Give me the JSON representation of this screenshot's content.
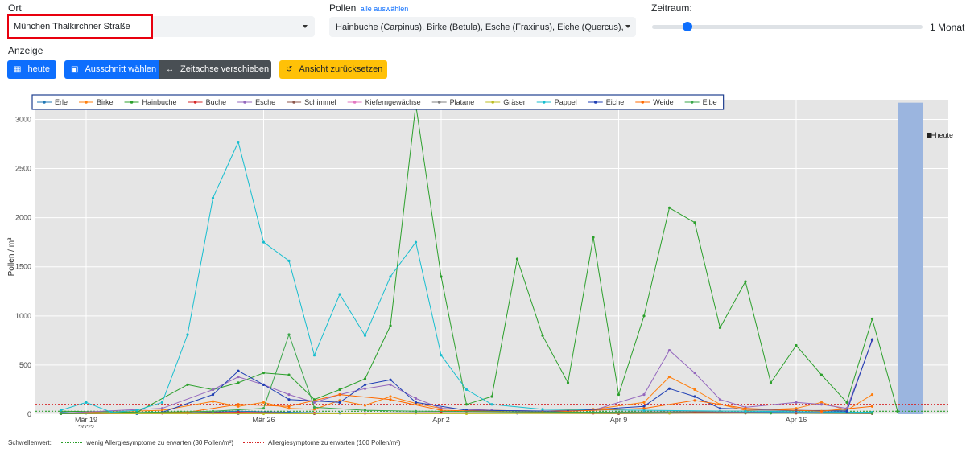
{
  "controls": {
    "ort_label": "Ort",
    "ort_value": "München Thalkirchner Straße",
    "pollen_label": "Pollen",
    "pollen_select_all": "alle auswählen",
    "pollen_value": "Hainbuche (Carpinus), Birke (Betula), Esche (Fraxinus), Eiche (Quercus), Pappe",
    "zeitraum_label": "Zeitraum:",
    "zeitraum_value": "1 Monat",
    "zeitraum_slider_fraction": 0.13,
    "anzeige_label": "Anzeige"
  },
  "buttons": {
    "heute": "heute",
    "ausschnitt": "Ausschnitt wählen",
    "zeitachse": "Zeitachse verschieben",
    "reset": "Ansicht zurücksetzen"
  },
  "colors": {
    "primary": "#0d6efd",
    "dark": "#212529",
    "warning": "#ffc107",
    "highlight_border": "#e8000e",
    "plot_bg": "#e5e5e5",
    "today_bar": "#9bb5df",
    "threshold_low": "#2ca02c",
    "threshold_high": "#d62728"
  },
  "legend_footer": {
    "label": "Schwellenwert:",
    "low": "wenig Allergiesymptome zu erwarten (30 Pollen/m³)",
    "high": "Allergiesymptome zu erwarten (100 Pollen/m³)"
  },
  "chart_data": {
    "type": "line",
    "ylabel": "Pollen / m³",
    "xlim": [
      "2023-03-17",
      "2023-04-22"
    ],
    "ylim": [
      0,
      3200
    ],
    "yticks": [
      0,
      500,
      1000,
      1500,
      2000,
      2500,
      3000
    ],
    "xticks": [
      {
        "date": "2023-03-19",
        "label": "Mär 19",
        "sublabel": "2023"
      },
      {
        "date": "2023-03-26",
        "label": "Mär 26",
        "sublabel": ""
      },
      {
        "date": "2023-04-02",
        "label": "Apr 2",
        "sublabel": ""
      },
      {
        "date": "2023-04-09",
        "label": "Apr 9",
        "sublabel": ""
      },
      {
        "date": "2023-04-16",
        "label": "Apr 16",
        "sublabel": ""
      }
    ],
    "today": {
      "label": "heute",
      "start": "2023-04-20",
      "end": "2023-04-21"
    },
    "thresholds": [
      {
        "value": 30,
        "color": "#2ca02c"
      },
      {
        "value": 100,
        "color": "#d62728"
      }
    ],
    "legend_position": "top-left",
    "grid": true,
    "series": [
      {
        "name": "Erle",
        "color": "#1f77b4",
        "points": [
          [
            "2023-03-18",
            20
          ],
          [
            "2023-03-19",
            10
          ],
          [
            "2023-03-21",
            5
          ],
          [
            "2023-03-23",
            15
          ],
          [
            "2023-03-25",
            30
          ],
          [
            "2023-03-27",
            20
          ],
          [
            "2023-03-29",
            10
          ],
          [
            "2023-04-01",
            15
          ],
          [
            "2023-04-05",
            10
          ],
          [
            "2023-04-10",
            20
          ],
          [
            "2023-04-15",
            20
          ],
          [
            "2023-04-19",
            20
          ]
        ]
      },
      {
        "name": "Birke",
        "color": "#ff7f0e",
        "points": [
          [
            "2023-03-18",
            10
          ],
          [
            "2023-03-22",
            40
          ],
          [
            "2023-03-24",
            130
          ],
          [
            "2023-03-25",
            80
          ],
          [
            "2023-03-26",
            120
          ],
          [
            "2023-03-27",
            60
          ],
          [
            "2023-03-28",
            50
          ],
          [
            "2023-03-29",
            140
          ],
          [
            "2023-03-30",
            90
          ],
          [
            "2023-03-31",
            180
          ],
          [
            "2023-04-01",
            110
          ],
          [
            "2023-04-02",
            60
          ],
          [
            "2023-04-04",
            40
          ],
          [
            "2023-04-06",
            30
          ],
          [
            "2023-04-08",
            50
          ],
          [
            "2023-04-10",
            120
          ],
          [
            "2023-04-11",
            380
          ],
          [
            "2023-04-12",
            250
          ],
          [
            "2023-04-13",
            100
          ],
          [
            "2023-04-14",
            40
          ],
          [
            "2023-04-16",
            60
          ],
          [
            "2023-04-17",
            120
          ],
          [
            "2023-04-18",
            40
          ],
          [
            "2023-04-19",
            200
          ]
        ]
      },
      {
        "name": "Hainbuche",
        "color": "#2ca02c",
        "points": [
          [
            "2023-03-18",
            30
          ],
          [
            "2023-03-21",
            20
          ],
          [
            "2023-03-23",
            300
          ],
          [
            "2023-03-24",
            250
          ],
          [
            "2023-03-25",
            320
          ],
          [
            "2023-03-26",
            420
          ],
          [
            "2023-03-27",
            400
          ],
          [
            "2023-03-28",
            150
          ],
          [
            "2023-03-29",
            250
          ],
          [
            "2023-03-30",
            360
          ],
          [
            "2023-03-31",
            900
          ],
          [
            "2023-04-01",
            3150
          ],
          [
            "2023-04-02",
            1400
          ],
          [
            "2023-04-03",
            100
          ],
          [
            "2023-04-04",
            180
          ],
          [
            "2023-04-05",
            1580
          ],
          [
            "2023-04-06",
            800
          ],
          [
            "2023-04-07",
            320
          ],
          [
            "2023-04-08",
            1800
          ],
          [
            "2023-04-09",
            200
          ],
          [
            "2023-04-10",
            1000
          ],
          [
            "2023-04-11",
            2100
          ],
          [
            "2023-04-12",
            1950
          ],
          [
            "2023-04-13",
            880
          ],
          [
            "2023-04-14",
            1350
          ],
          [
            "2023-04-15",
            320
          ],
          [
            "2023-04-16",
            700
          ],
          [
            "2023-04-17",
            400
          ],
          [
            "2023-04-18",
            120
          ],
          [
            "2023-04-19",
            970
          ],
          [
            "2023-04-20",
            30
          ]
        ]
      },
      {
        "name": "Buche",
        "color": "#d62728",
        "points": [
          [
            "2023-03-18",
            5
          ],
          [
            "2023-03-22",
            10
          ],
          [
            "2023-03-25",
            20
          ],
          [
            "2023-03-28",
            10
          ],
          [
            "2023-04-02",
            15
          ],
          [
            "2023-04-08",
            10
          ],
          [
            "2023-04-12",
            20
          ],
          [
            "2023-04-16",
            10
          ],
          [
            "2023-04-19",
            15
          ]
        ]
      },
      {
        "name": "Esche",
        "color": "#9467bd",
        "points": [
          [
            "2023-03-18",
            10
          ],
          [
            "2023-03-22",
            60
          ],
          [
            "2023-03-24",
            250
          ],
          [
            "2023-03-25",
            380
          ],
          [
            "2023-03-26",
            300
          ],
          [
            "2023-03-27",
            200
          ],
          [
            "2023-03-28",
            120
          ],
          [
            "2023-03-29",
            200
          ],
          [
            "2023-03-30",
            260
          ],
          [
            "2023-03-31",
            300
          ],
          [
            "2023-04-01",
            160
          ],
          [
            "2023-04-02",
            60
          ],
          [
            "2023-04-04",
            40
          ],
          [
            "2023-04-06",
            30
          ],
          [
            "2023-04-08",
            40
          ],
          [
            "2023-04-10",
            200
          ],
          [
            "2023-04-11",
            650
          ],
          [
            "2023-04-12",
            420
          ],
          [
            "2023-04-13",
            150
          ],
          [
            "2023-04-14",
            70
          ],
          [
            "2023-04-16",
            120
          ],
          [
            "2023-04-17",
            100
          ],
          [
            "2023-04-18",
            60
          ],
          [
            "2023-04-19",
            750
          ]
        ]
      },
      {
        "name": "Schimmel",
        "color": "#8c564b",
        "points": [
          [
            "2023-03-18",
            5
          ],
          [
            "2023-03-23",
            10
          ],
          [
            "2023-03-28",
            5
          ],
          [
            "2023-04-03",
            10
          ],
          [
            "2023-04-09",
            5
          ],
          [
            "2023-04-14",
            10
          ],
          [
            "2023-04-19",
            5
          ]
        ]
      },
      {
        "name": "Kieferngewächse",
        "color": "#e377c2",
        "points": [
          [
            "2023-03-18",
            5
          ],
          [
            "2023-03-24",
            10
          ],
          [
            "2023-03-30",
            8
          ],
          [
            "2023-04-05",
            12
          ],
          [
            "2023-04-11",
            10
          ],
          [
            "2023-04-17",
            15
          ]
        ]
      },
      {
        "name": "Platane",
        "color": "#7f7f7f",
        "points": [
          [
            "2023-03-18",
            5
          ],
          [
            "2023-03-25",
            5
          ],
          [
            "2023-04-01",
            10
          ],
          [
            "2023-04-08",
            20
          ],
          [
            "2023-04-13",
            30
          ],
          [
            "2023-04-18",
            40
          ]
        ]
      },
      {
        "name": "Gräser",
        "color": "#bcbd22",
        "points": [
          [
            "2023-03-18",
            5
          ],
          [
            "2023-03-26",
            5
          ],
          [
            "2023-04-03",
            5
          ],
          [
            "2023-04-11",
            10
          ],
          [
            "2023-04-19",
            10
          ]
        ]
      },
      {
        "name": "Pappel",
        "color": "#17becf",
        "points": [
          [
            "2023-03-18",
            40
          ],
          [
            "2023-03-19",
            120
          ],
          [
            "2023-03-20",
            20
          ],
          [
            "2023-03-21",
            40
          ],
          [
            "2023-03-22",
            120
          ],
          [
            "2023-03-23",
            810
          ],
          [
            "2023-03-24",
            2200
          ],
          [
            "2023-03-25",
            2770
          ],
          [
            "2023-03-26",
            1750
          ],
          [
            "2023-03-27",
            1560
          ],
          [
            "2023-03-28",
            600
          ],
          [
            "2023-03-29",
            1220
          ],
          [
            "2023-03-30",
            800
          ],
          [
            "2023-03-31",
            1400
          ],
          [
            "2023-04-01",
            1750
          ],
          [
            "2023-04-02",
            600
          ],
          [
            "2023-04-03",
            250
          ],
          [
            "2023-04-04",
            100
          ],
          [
            "2023-04-06",
            50
          ],
          [
            "2023-04-10",
            40
          ],
          [
            "2023-04-14",
            30
          ],
          [
            "2023-04-19",
            20
          ]
        ]
      },
      {
        "name": "Eiche",
        "color": "#1f3fb4",
        "points": [
          [
            "2023-03-18",
            5
          ],
          [
            "2023-03-22",
            20
          ],
          [
            "2023-03-24",
            200
          ],
          [
            "2023-03-25",
            440
          ],
          [
            "2023-03-26",
            300
          ],
          [
            "2023-03-27",
            150
          ],
          [
            "2023-03-29",
            120
          ],
          [
            "2023-03-30",
            300
          ],
          [
            "2023-03-31",
            350
          ],
          [
            "2023-04-01",
            120
          ],
          [
            "2023-04-03",
            40
          ],
          [
            "2023-04-07",
            30
          ],
          [
            "2023-04-10",
            80
          ],
          [
            "2023-04-11",
            260
          ],
          [
            "2023-04-12",
            180
          ],
          [
            "2023-04-13",
            60
          ],
          [
            "2023-04-16",
            40
          ],
          [
            "2023-04-18",
            30
          ],
          [
            "2023-04-19",
            760
          ]
        ]
      },
      {
        "name": "Weide",
        "color": "#ff6a00",
        "points": [
          [
            "2023-03-18",
            5
          ],
          [
            "2023-03-23",
            20
          ],
          [
            "2023-03-25",
            100
          ],
          [
            "2023-03-27",
            80
          ],
          [
            "2023-03-29",
            200
          ],
          [
            "2023-03-31",
            150
          ],
          [
            "2023-04-02",
            40
          ],
          [
            "2023-04-06",
            20
          ],
          [
            "2023-04-10",
            60
          ],
          [
            "2023-04-12",
            140
          ],
          [
            "2023-04-14",
            60
          ],
          [
            "2023-04-17",
            30
          ],
          [
            "2023-04-19",
            80
          ]
        ]
      },
      {
        "name": "Eibe",
        "color": "#3aa64a",
        "points": [
          [
            "2023-03-18",
            5
          ],
          [
            "2023-03-24",
            30
          ],
          [
            "2023-03-26",
            60
          ],
          [
            "2023-03-27",
            810
          ],
          [
            "2023-03-28",
            70
          ],
          [
            "2023-03-30",
            40
          ],
          [
            "2023-04-01",
            30
          ],
          [
            "2023-04-08",
            20
          ],
          [
            "2023-04-15",
            10
          ],
          [
            "2023-04-19",
            10
          ]
        ]
      }
    ]
  }
}
